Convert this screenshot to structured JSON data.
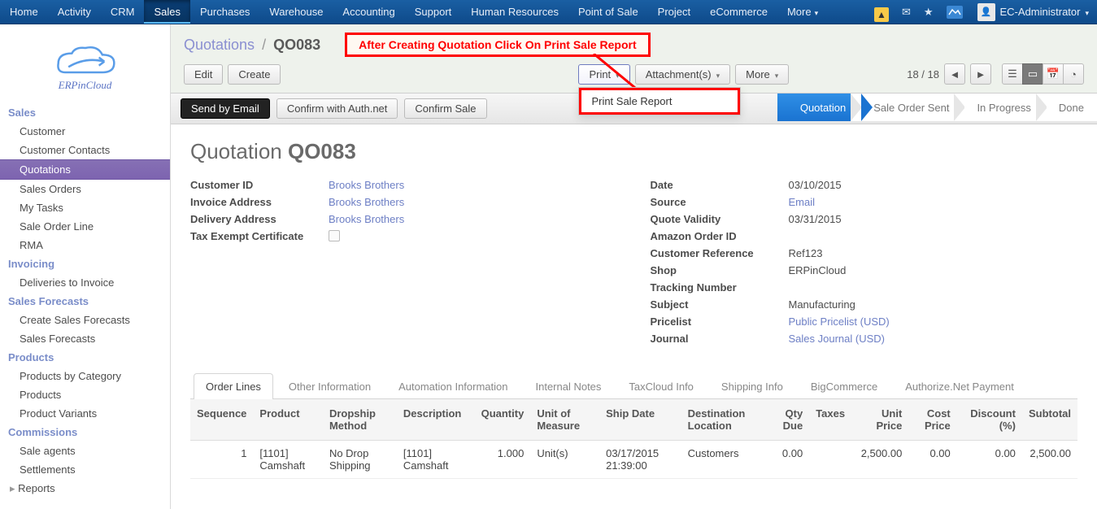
{
  "topnav": {
    "items": [
      "Home",
      "Activity",
      "CRM",
      "Sales",
      "Purchases",
      "Warehouse",
      "Accounting",
      "Support",
      "Human Resources",
      "Point of Sale",
      "Project",
      "eCommerce"
    ],
    "more": "More",
    "user": "EC-Administrator"
  },
  "sidebar": {
    "logo_text": "ERPinCloud",
    "sections": [
      {
        "title": "Sales",
        "items": [
          "Customer",
          "Customer Contacts",
          "Quotations",
          "Sales Orders",
          "My Tasks",
          "Sale Order Line",
          "RMA"
        ],
        "active_index": 2
      },
      {
        "title": "Invoicing",
        "items": [
          "Deliveries to Invoice"
        ]
      },
      {
        "title": "Sales Forecasts",
        "items": [
          "Create Sales Forecasts",
          "Sales Forecasts"
        ]
      },
      {
        "title": "Products",
        "items": [
          "Products by Category",
          "Products",
          "Product Variants"
        ]
      },
      {
        "title": "Commissions",
        "items": [
          "Sale agents",
          "Settlements",
          "Reports"
        ],
        "caret_last": true
      }
    ]
  },
  "header": {
    "breadcrumb_root": "Quotations",
    "breadcrumb_current": "QO083",
    "btn_edit": "Edit",
    "btn_create": "Create",
    "btn_print": "Print",
    "btn_attach": "Attachment(s)",
    "btn_more": "More",
    "pager": "18 / 18",
    "print_menu": [
      "Print Sale Report"
    ],
    "annotation": "After Creating Quotation Click On Print Sale Report"
  },
  "workflow": {
    "send_email": "Send by Email",
    "confirm_auth": "Confirm with Auth.net",
    "confirm_sale": "Confirm Sale",
    "stages": [
      "Quotation",
      "Sale Order Sent",
      "In Progress",
      "Done"
    ],
    "active_stage_index": 0
  },
  "form": {
    "title_prefix": "Quotation ",
    "title_id": "QO083",
    "left": {
      "customer_id_lbl": "Customer ID",
      "customer_id": "Brooks Brothers",
      "invoice_addr_lbl": "Invoice Address",
      "invoice_addr": "Brooks Brothers",
      "delivery_addr_lbl": "Delivery Address",
      "delivery_addr": "Brooks Brothers",
      "tax_exempt_lbl": "Tax Exempt Certificate"
    },
    "right": {
      "date_lbl": "Date",
      "date": "03/10/2015",
      "source_lbl": "Source",
      "source": "Email",
      "quote_validity_lbl": "Quote Validity",
      "quote_validity": "03/31/2015",
      "amazon_lbl": "Amazon Order ID",
      "amazon": "",
      "custref_lbl": "Customer Reference",
      "custref": "Ref123",
      "shop_lbl": "Shop",
      "shop": "ERPinCloud",
      "tracking_lbl": "Tracking Number",
      "tracking": "",
      "subject_lbl": "Subject",
      "subject": "Manufacturing",
      "pricelist_lbl": "Pricelist",
      "pricelist": "Public Pricelist (USD)",
      "journal_lbl": "Journal",
      "journal": "Sales Journal (USD)"
    }
  },
  "tabs": [
    "Order Lines",
    "Other Information",
    "Automation Information",
    "Internal Notes",
    "TaxCloud Info",
    "Shipping Info",
    "BigCommerce",
    "Authorize.Net Payment"
  ],
  "table": {
    "headers": [
      "Sequence",
      "Product",
      "Dropship Method",
      "Description",
      "Quantity",
      "Unit of Measure",
      "Ship Date",
      "Destination Location",
      "Qty Due",
      "Taxes",
      "Unit Price",
      "Cost Price",
      "Discount (%)",
      "Subtotal"
    ],
    "rows": [
      {
        "seq": "1",
        "product": "[1101] Camshaft",
        "dropship": "No Drop Shipping",
        "desc": "[1101] Camshaft",
        "qty": "1.000",
        "uom": "Unit(s)",
        "ship": "03/17/2015 21:39:00",
        "dest": "Customers",
        "qty_due": "0.00",
        "taxes": "",
        "unit_price": "2,500.00",
        "cost_price": "0.00",
        "discount": "0.00",
        "subtotal": "2,500.00"
      }
    ]
  }
}
